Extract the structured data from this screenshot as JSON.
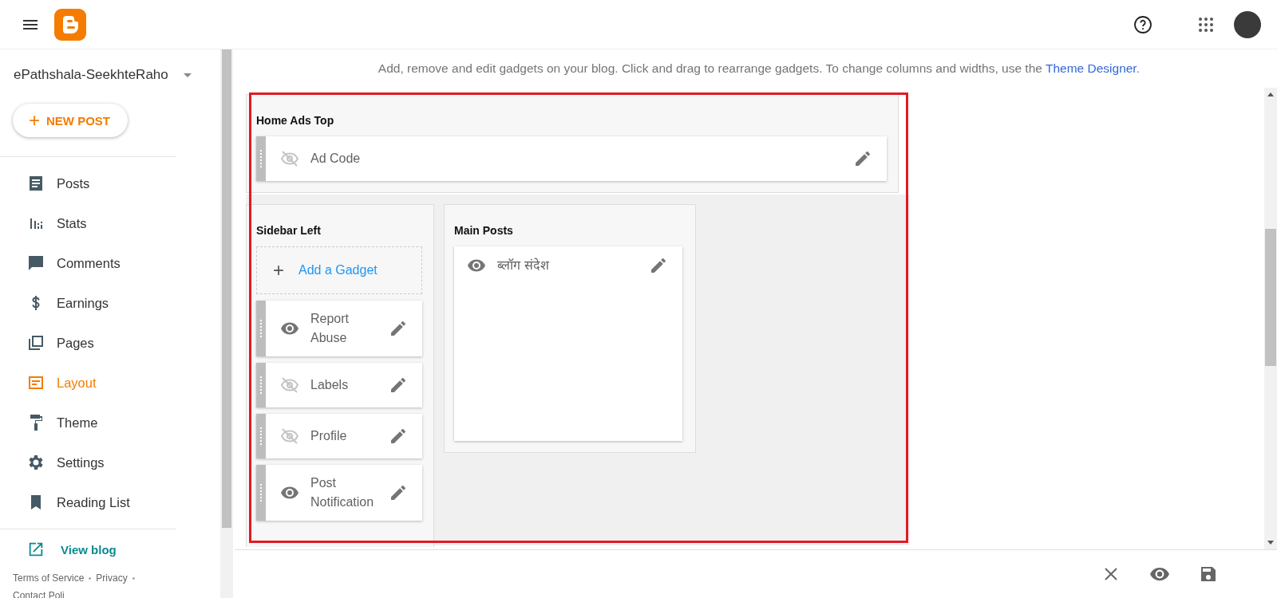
{
  "blog_selector": {
    "name": "ePathshala-SeekhteRaho"
  },
  "new_post_button": {
    "icon": "+",
    "label": "NEW POST"
  },
  "nav": [
    {
      "label": "Posts",
      "selected": false
    },
    {
      "label": "Stats",
      "selected": false
    },
    {
      "label": "Comments",
      "selected": false
    },
    {
      "label": "Earnings",
      "selected": false
    },
    {
      "label": "Pages",
      "selected": false
    },
    {
      "label": "Layout",
      "selected": true
    },
    {
      "label": "Theme",
      "selected": false
    },
    {
      "label": "Settings",
      "selected": false
    },
    {
      "label": "Reading List",
      "selected": false
    }
  ],
  "view_blog": "View blog",
  "footer_links": [
    "Terms of Service",
    "Privacy",
    "Contact Poli"
  ],
  "intro": {
    "text": "Add, remove and edit gadgets on your blog. Click and drag to rearrange gadgets. To change columns and widths, use the ",
    "link": "Theme Designer",
    "end": "."
  },
  "sections": [
    {
      "title": "Home Ads Top",
      "gadgets": [
        {
          "name": "Ad Code",
          "visible": false
        }
      ]
    },
    {
      "title": "Sidebar Left",
      "add_gadget": {
        "icon": "+",
        "label": "Add a Gadget"
      },
      "gadgets": [
        {
          "name": "Report Abuse",
          "visible": true
        },
        {
          "name": "Labels",
          "visible": false
        },
        {
          "name": "Profile",
          "visible": false
        },
        {
          "name": "Post Notification",
          "visible": true
        }
      ]
    },
    {
      "title": "Main Posts",
      "gadgets": [
        {
          "name": "ब्लॉग संदेश",
          "visible": true
        }
      ]
    }
  ]
}
